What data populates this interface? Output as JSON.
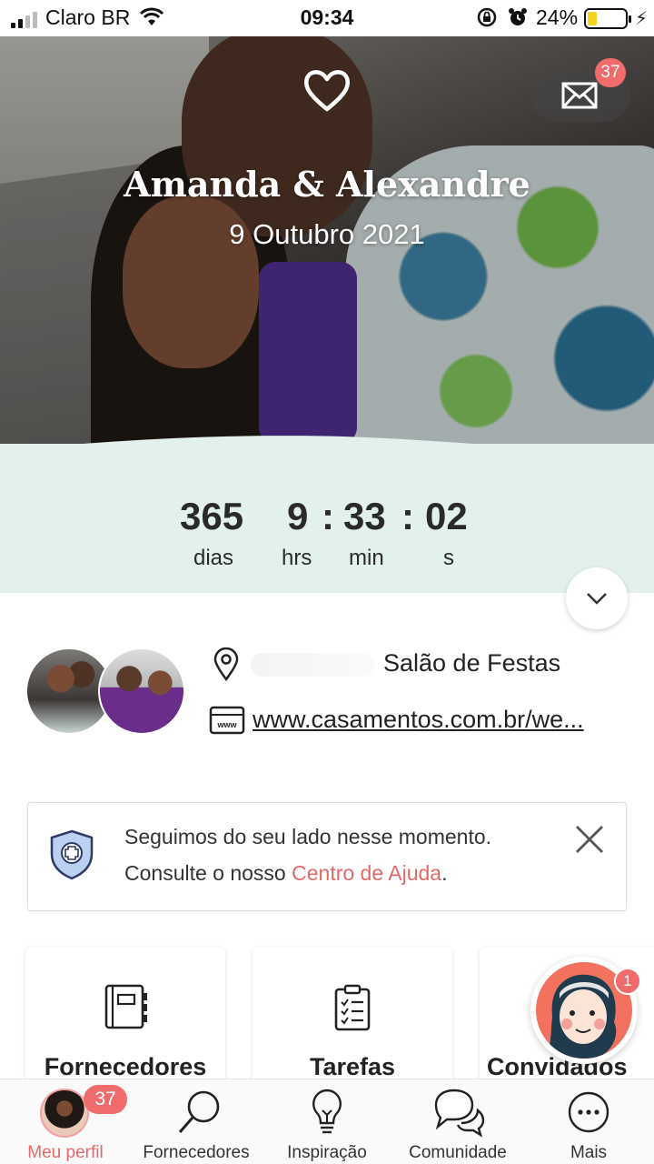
{
  "status_bar": {
    "carrier": "Claro BR",
    "time": "09:34",
    "battery_pct": "24%",
    "battery_level": 0.24,
    "battery_color": "#f5d21e"
  },
  "hero": {
    "couple_names": "Amanda & Alexandre",
    "date": "9 Outubro 2021",
    "icons": [
      "heart-icon",
      "mail-icon"
    ],
    "mail_badge": "37"
  },
  "countdown": {
    "days": "365",
    "hours": "9",
    "minutes": "33",
    "seconds": "02",
    "separator": ":",
    "days_label": "dias",
    "hours_label": "hrs",
    "minutes_label": "min",
    "seconds_label": "s"
  },
  "profile": {
    "venue": "Salão de Festas",
    "website": "www.casamentos.com.br/we..."
  },
  "help_card": {
    "line1": "Seguimos do seu lado nesse momento.",
    "line2_prefix": "Consulte o nosso ",
    "link": "Centro de Ajuda",
    "line2_suffix": "."
  },
  "tools": [
    {
      "label": "Fornecedores",
      "icon": "notebook-icon"
    },
    {
      "label": "Tarefas",
      "icon": "clipboard-icon"
    },
    {
      "label": "Convidados",
      "icon": "guests-icon"
    }
  ],
  "assistant": {
    "badge": "1"
  },
  "bottom_nav": {
    "items": [
      {
        "label": "Meu perfil",
        "badge": "37",
        "icon": "avatar"
      },
      {
        "label": "Fornecedores",
        "icon": "search-icon"
      },
      {
        "label": "Inspiração",
        "icon": "lightbulb-icon"
      },
      {
        "label": "Comunidade",
        "icon": "chat-icon"
      },
      {
        "label": "Mais",
        "icon": "more-icon"
      }
    ]
  },
  "colors": {
    "accent": "#e06a6a",
    "badge": "#f06b6b",
    "countdown_bg": "#e2f1ec"
  }
}
